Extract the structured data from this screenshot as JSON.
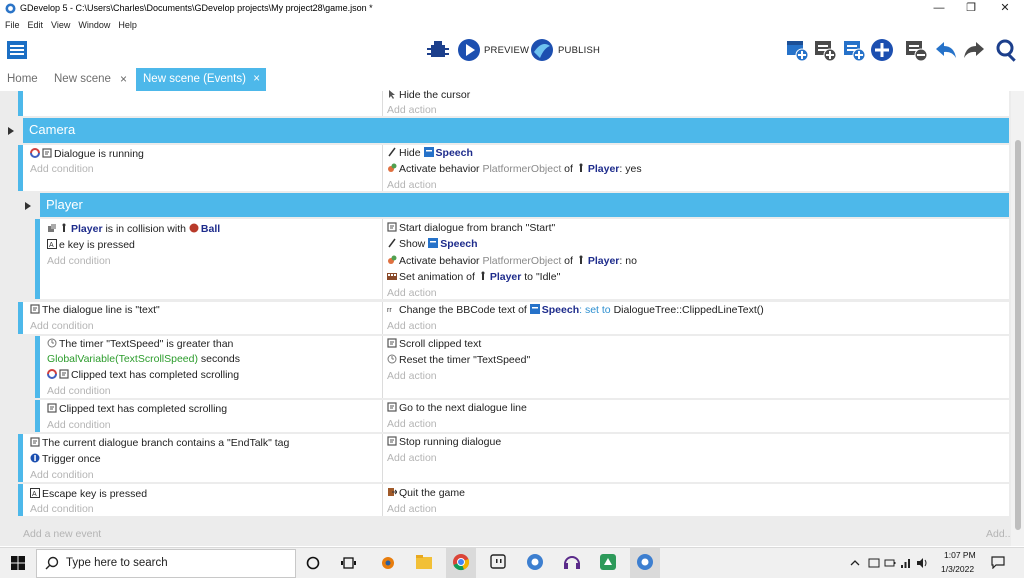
{
  "window": {
    "title": "GDevelop 5 - C:\\Users\\Charles\\Documents\\GDevelop projects\\My project28\\game.json *",
    "minimize": "—",
    "restore": "❐",
    "close": "✕"
  },
  "menu": [
    "File",
    "Edit",
    "View",
    "Window",
    "Help"
  ],
  "toolbar": {
    "preview_label": "PREVIEW",
    "publish_label": "PUBLISH"
  },
  "tabs": {
    "home": "Home",
    "scene": "New scene",
    "events": "New scene (Events)",
    "close": "×"
  },
  "events": {
    "e0": {
      "action": "Hide the cursor",
      "add_action": "Add action"
    },
    "camera": {
      "title": "Camera"
    },
    "e1": {
      "condition": "Dialogue is running",
      "add_condition": "Add condition",
      "a1_pre": "Hide",
      "a1_obj": "Speech",
      "a2_pre": "Activate behavior",
      "a2_beh": "PlatformerObject",
      "a2_of": "of",
      "a2_obj": "Player",
      "a2_val": ": yes",
      "add_action": "Add action"
    },
    "player": {
      "title": "Player"
    },
    "e2": {
      "c1_obj": "Player",
      "c1_mid": "is in collision with",
      "c1_obj2": "Ball",
      "c2": "e  key is pressed",
      "add_condition": "Add condition",
      "a1": "Start dialogue from branch \"Start\"",
      "a2_pre": "Show",
      "a2_obj": "Speech",
      "a3_pre": "Activate behavior",
      "a3_beh": "PlatformerObject",
      "a3_of": "of",
      "a3_obj": "Player",
      "a3_val": ": no",
      "a4_pre": "Set animation of",
      "a4_obj": "Player",
      "a4_post": "to \"Idle\"",
      "add_action": "Add action"
    },
    "e3": {
      "condition": "The dialogue line is \"text\"",
      "add_condition": "Add condition",
      "a1_pre": "Change the BBCode text of",
      "a1_obj": "Speech",
      "a1_set": ": set to",
      "a1_val": "DialogueTree::ClippedLineText()",
      "add_action": "Add action"
    },
    "e4": {
      "c1_a": "The timer \"TextSpeed\" is greater than",
      "c1_b": "GlobalVariable(TextScrollSpeed)",
      "c1_c": "seconds",
      "c2": "Clipped text has completed scrolling",
      "add_condition": "Add condition",
      "a1": "Scroll clipped text",
      "a2": "Reset the timer \"TextSpeed\"",
      "add_action": "Add action"
    },
    "e5": {
      "condition": "Clipped text has completed scrolling",
      "add_condition": "Add condition",
      "a1": "Go to the next dialogue line",
      "add_action": "Add action"
    },
    "e6": {
      "c1": "The current dialogue branch contains a \"EndTalk\" tag",
      "c2": "Trigger once",
      "add_condition": "Add condition",
      "a1": "Stop running dialogue",
      "add_action": "Add action"
    },
    "e7": {
      "condition": "Escape  key is pressed",
      "add_condition": "Add condition",
      "a1": "Quit the game",
      "add_action": "Add action"
    },
    "add_event": "Add a new event",
    "add_more": "Add..."
  },
  "taskbar": {
    "search_placeholder": "Type here to search",
    "time": "1:07 PM",
    "date": "1/3/2022"
  },
  "colors": {
    "accent": "#4db8ea",
    "placeholder": "#b4b4b4",
    "object": "#1e2c8c"
  }
}
